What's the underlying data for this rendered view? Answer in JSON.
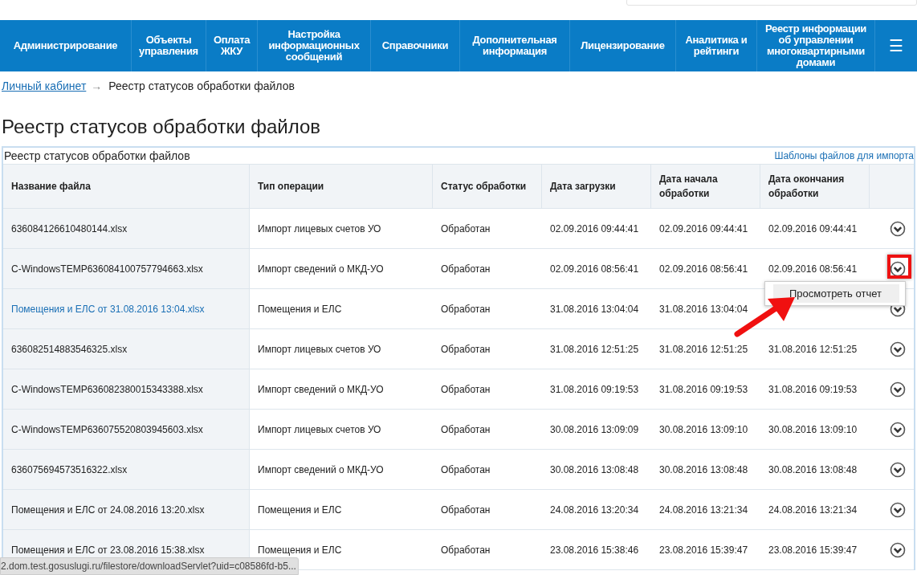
{
  "nav": {
    "items": [
      "Администрирование",
      "Объекты управления",
      "Оплата ЖКУ",
      "Настройка информационных сообщений",
      "Справочники",
      "Дополнительная информация",
      "Лицензирование",
      "Аналитика и рейтинги",
      "Реестр информации об управлении многоквартирными домами"
    ],
    "menu_icon": "☰"
  },
  "breadcrumb": {
    "link": "Личный кабинет",
    "arrow": "→",
    "current": "Реестр статусов обработки файлов"
  },
  "page_title": "Реестр статусов обработки файлов",
  "table": {
    "caption": "Реестр статусов обработки файлов",
    "templates_link": "Шаблоны файлов для импорта",
    "columns": [
      "Название файла",
      "Тип операции",
      "Статус обработки",
      "Дата загрузки",
      "Дата начала обработки",
      "Дата окончания обработки"
    ],
    "rows": [
      {
        "cells": [
          "636084126610480144.xlsx",
          "Импорт лицевых счетов УО",
          "Обработан",
          "02.09.2016 09:44:41",
          "02.09.2016 09:44:41",
          "02.09.2016 09:44:41"
        ],
        "link": false,
        "highlighted": false
      },
      {
        "cells": [
          "C-WindowsTEMP636084100757794663.xlsx",
          "Импорт сведений о МКД-УО",
          "Обработан",
          "02.09.2016 08:56:41",
          "02.09.2016 08:56:41",
          "02.09.2016 08:56:41"
        ],
        "link": false,
        "highlighted": true,
        "menu": [
          "Просмотреть отчет"
        ]
      },
      {
        "cells": [
          "Помещения и ЕЛС от 31.08.2016 13:04.xlsx",
          "Помещения и ЕЛС",
          "Обработан",
          "31.08.2016 13:04:04",
          "31.08.2016 13:04:04"
        ],
        "link": true,
        "highlighted": false
      },
      {
        "cells": [
          "636082514883546325.xlsx",
          "Импорт лицевых счетов УО",
          "Обработан",
          "31.08.2016 12:51:25",
          "31.08.2016 12:51:25",
          "31.08.2016 12:51:25"
        ],
        "link": false,
        "highlighted": false
      },
      {
        "cells": [
          "C-WindowsTEMP636082380015343388.xlsx",
          "Импорт сведений о МКД-УО",
          "Обработан",
          "31.08.2016 09:19:53",
          "31.08.2016 09:19:53",
          "31.08.2016 09:19:53"
        ],
        "link": false,
        "highlighted": false
      },
      {
        "cells": [
          "C-WindowsTEMP636075520803945603.xlsx",
          "Импорт лицевых счетов УО",
          "Обработан",
          "30.08.2016 13:09:09",
          "30.08.2016 13:09:10",
          "30.08.2016 13:09:10"
        ],
        "link": false,
        "highlighted": false
      },
      {
        "cells": [
          "636075694573516322.xlsx",
          "Импорт сведений о МКД-УО",
          "Обработан",
          "30.08.2016 13:08:48",
          "30.08.2016 13:08:48",
          "30.08.2016 13:08:48"
        ],
        "link": false,
        "highlighted": false
      },
      {
        "cells": [
          "Помещения и ЕЛС от 24.08.2016 13:20.xlsx",
          "Помещения и ЕЛС",
          "Обработан",
          "24.08.2016 13:20:34",
          "24.08.2016 13:21:34",
          "24.08.2016 13:21:34"
        ],
        "link": false,
        "highlighted": false
      },
      {
        "cells": [
          "Помещения и ЕЛС от 23.08.2016 15:38.xlsx",
          "Помещения и ЕЛС",
          "Обработан",
          "23.08.2016 15:38:46",
          "23.08.2016 15:39:47",
          "23.08.2016 15:39:47"
        ],
        "link": false,
        "highlighted": false
      }
    ]
  },
  "status_bar": "2.dom.test.gosuslugi.ru/filestore/downloadServlet?uid=c08586fd-b5..."
}
